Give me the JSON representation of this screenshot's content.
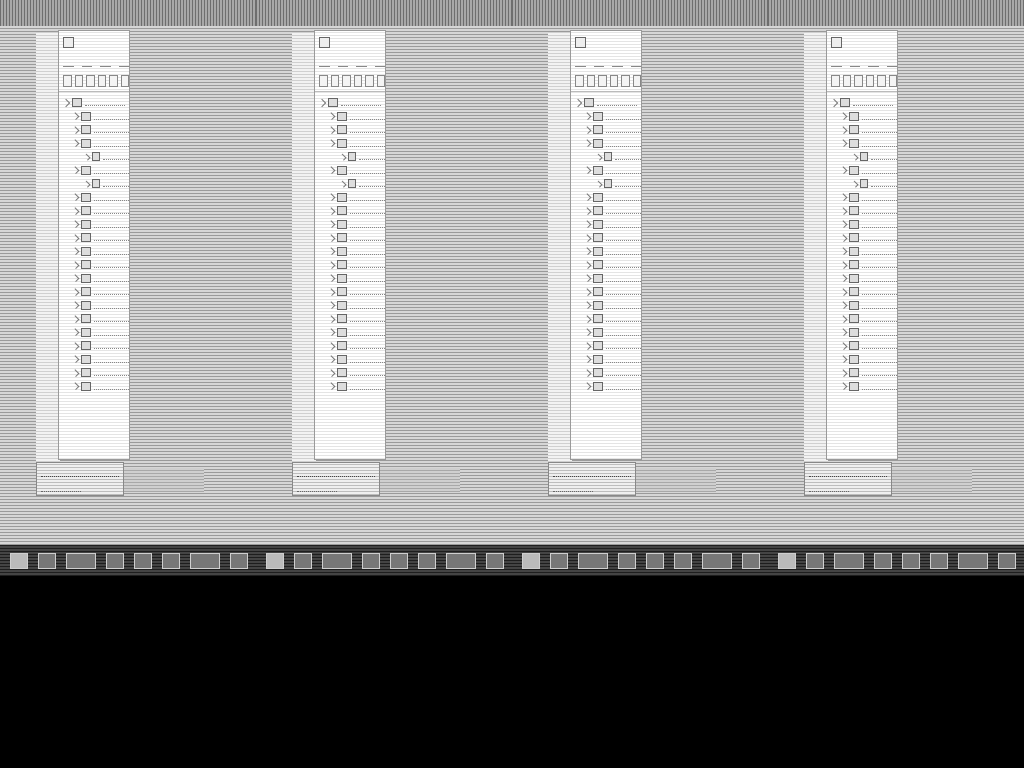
{
  "window": {
    "title": "",
    "menu": [
      "",
      "",
      "",
      ""
    ],
    "toolbar_buttons": [
      "back-icon",
      "forward-icon",
      "properties-icon",
      "help-icon",
      "refresh-icon",
      "monitor-icon"
    ]
  },
  "tree": [
    {
      "level": 0,
      "label": "",
      "icon": "computer-icon"
    },
    {
      "level": 1,
      "label": "",
      "icon": "device-icon"
    },
    {
      "level": 1,
      "label": "",
      "icon": "device-icon"
    },
    {
      "level": 1,
      "label": "",
      "icon": "device-icon"
    },
    {
      "level": 2,
      "label": "",
      "icon": "device-icon"
    },
    {
      "level": 1,
      "label": "",
      "icon": "device-icon"
    },
    {
      "level": 2,
      "label": "",
      "icon": "device-icon"
    },
    {
      "level": 1,
      "label": "",
      "icon": "device-icon"
    },
    {
      "level": 1,
      "label": "",
      "icon": "device-icon"
    },
    {
      "level": 1,
      "label": "",
      "icon": "device-icon"
    },
    {
      "level": 1,
      "label": "",
      "icon": "device-icon"
    },
    {
      "level": 1,
      "label": "",
      "icon": "device-icon"
    },
    {
      "level": 1,
      "label": "",
      "icon": "device-icon"
    },
    {
      "level": 1,
      "label": "",
      "icon": "device-icon"
    },
    {
      "level": 1,
      "label": "",
      "icon": "device-icon"
    },
    {
      "level": 1,
      "label": "",
      "icon": "device-icon"
    },
    {
      "level": 1,
      "label": "",
      "icon": "device-icon"
    },
    {
      "level": 1,
      "label": "",
      "icon": "device-icon"
    },
    {
      "level": 1,
      "label": "",
      "icon": "device-icon"
    },
    {
      "level": 1,
      "label": "",
      "icon": "device-icon"
    },
    {
      "level": 1,
      "label": "",
      "icon": "device-icon"
    },
    {
      "level": 1,
      "label": "",
      "icon": "device-icon"
    }
  ],
  "status": {
    "text": "",
    "subtext": ""
  },
  "taskbar": [
    "start-icon",
    "search-icon",
    "task-view-icon",
    "file-explorer-icon",
    "app-icon",
    "app-icon",
    "app-icon",
    "device-manager-icon"
  ]
}
